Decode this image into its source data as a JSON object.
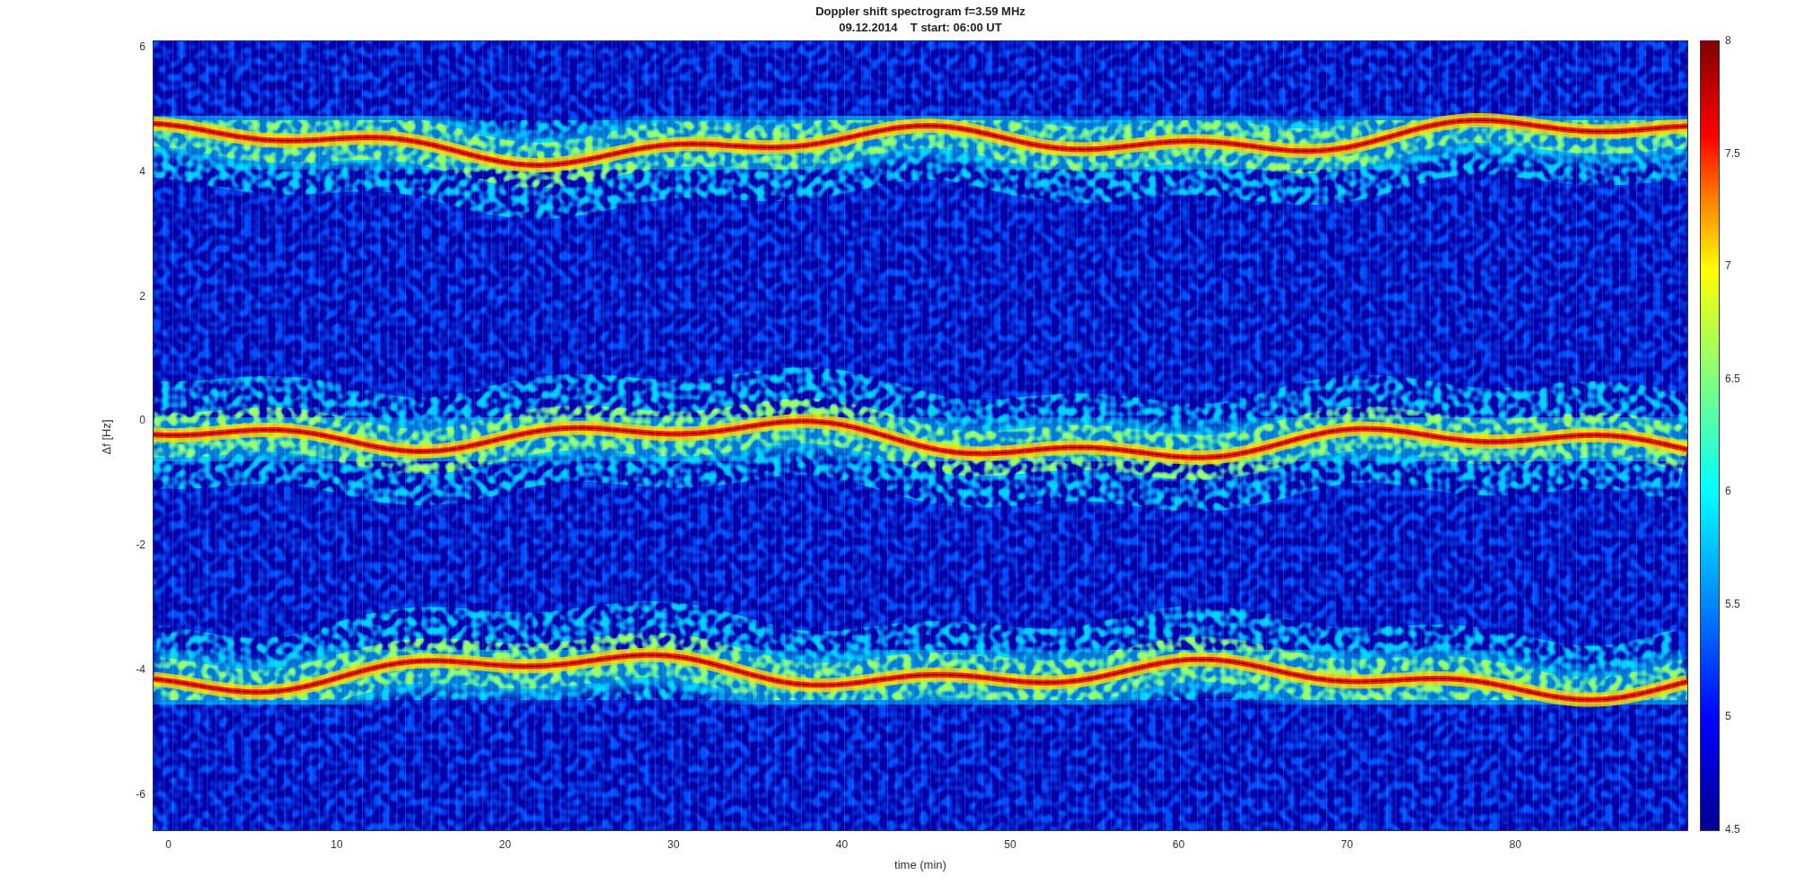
{
  "figure": {
    "title": "Doppler shift spectrogram f=3.59 MHz",
    "subtitle": "09.12.2014    T start: 06:00 UT",
    "xlabel": "time (min)",
    "ylabel": "Δf [Hz]",
    "xticks": [
      "0",
      "10",
      "20",
      "30",
      "40",
      "50",
      "60",
      "70",
      "80"
    ],
    "yticks": [
      "6",
      "4",
      "2",
      "0",
      "-2",
      "-4",
      "-6"
    ],
    "colorbar_ticks": [
      "8",
      "7.5",
      "7",
      "6.5",
      "6",
      "5.5",
      "5",
      "4.5"
    ]
  }
}
